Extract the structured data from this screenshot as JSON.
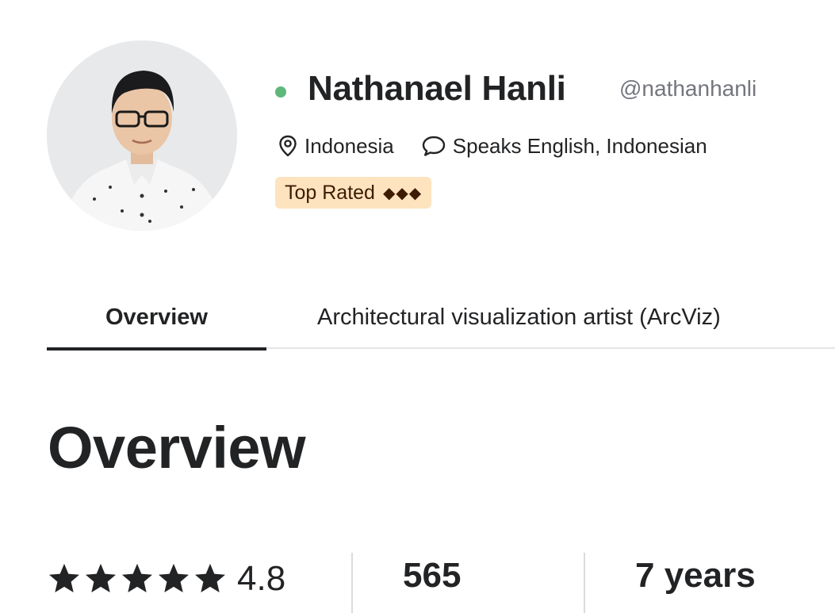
{
  "profile": {
    "name": "Nathanael Hanli",
    "username": "@nathanhanli",
    "online": true,
    "location": "Indonesia",
    "languages": "Speaks English, Indonesian",
    "badge": {
      "label": "Top Rated",
      "diamonds": "◆◆◆"
    }
  },
  "tabs": [
    {
      "label": "Overview",
      "active": true
    },
    {
      "label": "Architectural visualization artist (ArcViz)",
      "active": false
    }
  ],
  "section": {
    "title": "Overview"
  },
  "stats": {
    "rating": "4.8",
    "stars": 5,
    "count": "565",
    "experience": "7 years"
  },
  "icons": {
    "online": "online-status-dot",
    "location": "map-pin-icon",
    "languages": "speech-bubble-icon",
    "rating": "star-icon"
  },
  "colors": {
    "online": "#5fb87a",
    "badge_bg": "#fde4bf",
    "badge_text": "#3d1c03",
    "text": "#222325",
    "muted": "#74767e"
  }
}
